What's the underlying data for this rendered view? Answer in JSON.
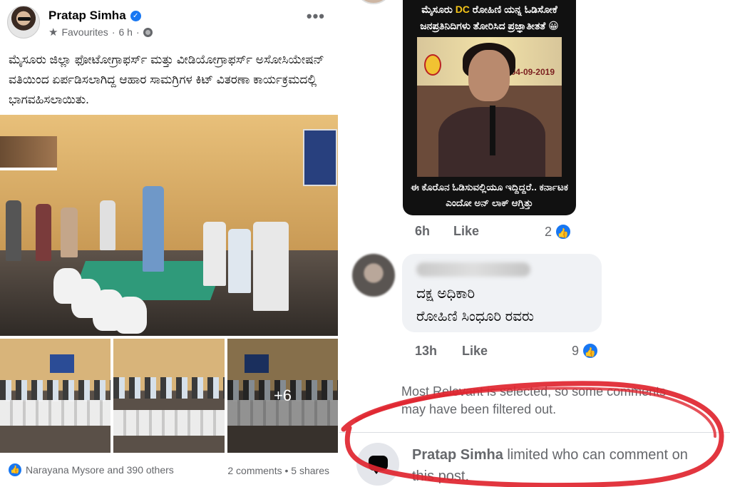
{
  "post": {
    "author": "Pratap Simha",
    "audience": "Favourites",
    "time": "6 h",
    "text": "ಮೈಸೂರು ಜಿಲ್ಲಾ ಫೋಟೋಗ್ರಾಫರ್ಸ್ ಮತ್ತು ವೀಡಿಯೋಗ್ರಾಫರ್ಸ್ ಅಸೋಸಿಯೇಷನ್ ವತಿಯಿಂದ ಏರ್ಪಡಿಸಲಾಗಿದ್ದ ಆಹಾರ ಸಾಮಗ್ರಿಗಳ ಕಿಟ್ ವಿತರಣಾ ಕಾರ್ಯಕ್ರಮದಲ್ಲಿ ಭಾಗವಹಿಸಲಾಯಿತು.",
    "more_photos": "+6",
    "reactions_text": "Narayana Mysore and 390 others",
    "comments_count": "2 comments",
    "shares_count": "5 shares"
  },
  "comment1": {
    "meme_top_pre": "ಮೈಸೂರು ",
    "meme_top_hl": "DC",
    "meme_top_post": " ರೋಹಿಣಿ ಯನ್ನ ಓಡಿಸೋಕೆ ಜನಪ್ರತಿನಿದಿಗಳು ತೋರಿಸಿದ ಪ್ರಜ್ಞಾತೀತತೆ 😀",
    "banner_date": "04-09-2019",
    "meme_bottom": "ಈ ಕೊರೊನ ಓಡಿಸುವಲ್ಲಿಯೂ ಇದ್ದಿದ್ದರೆ.. ಕರ್ನಾಟಕ ಎಂದೋ ಅನ್ ಲಾಕ್ ಆಗ್ತಿತ್ತು",
    "time": "6h",
    "like_label": "Like",
    "like_count": "2"
  },
  "comment2": {
    "line1": "ದಕ್ಷ ಅಧಿಕಾರಿ",
    "line2": "ರೋಹಿಣಿ ಸಿಂಧೂರಿ ರವರು",
    "time": "13h",
    "like_label": "Like",
    "like_count": "9"
  },
  "filter_note": "Most Relevant is selected, so some comments may have been filtered out.",
  "limit": {
    "name": "Pratap Simha",
    "text": " limited who can comment on this post."
  },
  "colors": {
    "facebook_blue": "#1877f2",
    "annotation_red": "#e0252f",
    "secondary_text": "#65676b"
  }
}
